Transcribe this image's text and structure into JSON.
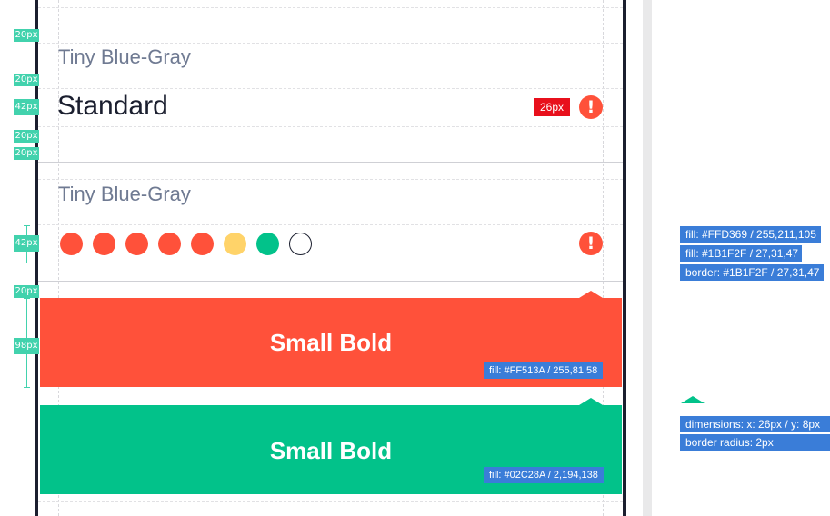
{
  "spacing_badges": {
    "s1": "20px",
    "s2": "20px",
    "s3": "42px",
    "s4": "20px",
    "s5": "20px",
    "s6": "42px",
    "s7": "20px",
    "s8": "98px"
  },
  "section1": {
    "label": "Tiny Blue-Gray",
    "title": "Standard",
    "icon_size_badge": "26px",
    "icon_glyph": "!"
  },
  "section2": {
    "label": "Tiny Blue-Gray",
    "icon_glyph": "!",
    "dots": [
      "#ff513a",
      "#ff513a",
      "#ff513a",
      "#ff513a",
      "#ff513a",
      "#ffd369",
      "#02c28a",
      "#ffffff"
    ]
  },
  "bands": {
    "red_label": "Small Bold",
    "red_fill": "fill: #FF513A / 255,81,58",
    "green_label": "Small Bold",
    "green_fill": "fill: #02C28A / 2,194,138"
  },
  "specs": {
    "dot_fill_yellow": "fill: #FFD369 / 255,211,105",
    "dot_fill_dark": "fill: #1B1F2F / 27,31,47",
    "dot_border_dark": "border: #1B1F2F / 27,31,47",
    "notch_dimensions": "dimensions: x: 26px / y: 8px",
    "notch_radius": "border radius: 2px"
  },
  "colors": {
    "red": "#ff513a",
    "green": "#02c28a",
    "yellow": "#ffd369",
    "dark": "#1b1f2f",
    "blue_gray": "#6f7a92",
    "annotation_blue": "#3a7dd8",
    "measure_green": "#42d2ad"
  }
}
